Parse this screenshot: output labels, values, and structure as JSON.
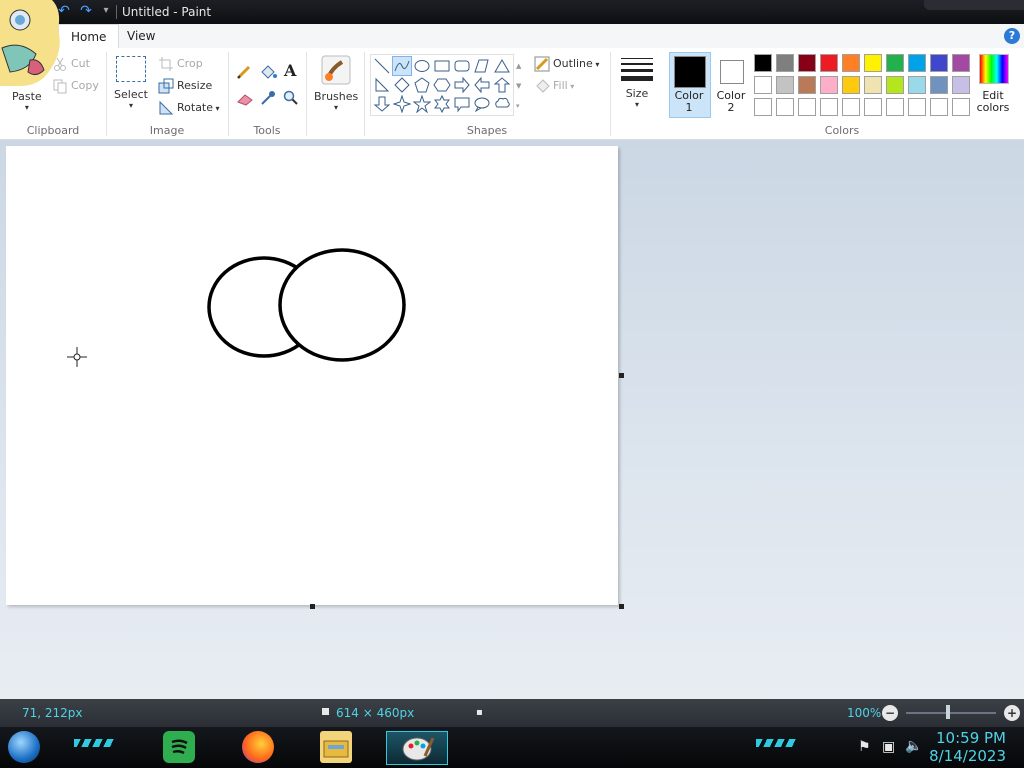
{
  "window": {
    "title": "Untitled - Paint"
  },
  "tabs": [
    {
      "label": "Home"
    },
    {
      "label": "View"
    }
  ],
  "clipboard": {
    "paste": "Paste",
    "cut": "Cut",
    "copy": "Copy",
    "group": "Clipboard"
  },
  "image": {
    "select": "Select",
    "crop": "Crop",
    "resize": "Resize",
    "rotate": "Rotate",
    "group": "Image"
  },
  "tools": {
    "group": "Tools"
  },
  "brushes": {
    "label": "Brushes"
  },
  "shapes": {
    "outline": "Outline",
    "fill": "Fill",
    "group": "Shapes"
  },
  "size": {
    "label": "Size"
  },
  "colors": {
    "color1_label": "Color",
    "color1_num": "1",
    "color2_label": "Color",
    "color2_num": "2",
    "edit_label_1": "Edit",
    "edit_label_2": "colors",
    "group": "Colors",
    "color1": "#000000",
    "color2": "#ffffff",
    "palette_row1": [
      "#000000",
      "#7f7f7f",
      "#880015",
      "#ed1c24",
      "#ff7f27",
      "#fff200",
      "#22b14c",
      "#00a2e8",
      "#3f48cc",
      "#a349a4"
    ],
    "palette_row2": [
      "#ffffff",
      "#c3c3c3",
      "#b97a57",
      "#ffaec9",
      "#ffc90e",
      "#efe4b0",
      "#b5e61d",
      "#99d9ea",
      "#7092be",
      "#c8bfe7"
    ],
    "palette_row3": [
      "#ffffff",
      "#ffffff",
      "#ffffff",
      "#ffffff",
      "#ffffff",
      "#ffffff",
      "#ffffff",
      "#ffffff",
      "#ffffff",
      "#ffffff"
    ]
  },
  "status": {
    "cursor_pos": "71, 212px",
    "canvas_size": "614 × 460px",
    "zoom": "100%"
  },
  "taskbar": {
    "time": "10:59 PM",
    "date": "8/14/2023"
  }
}
